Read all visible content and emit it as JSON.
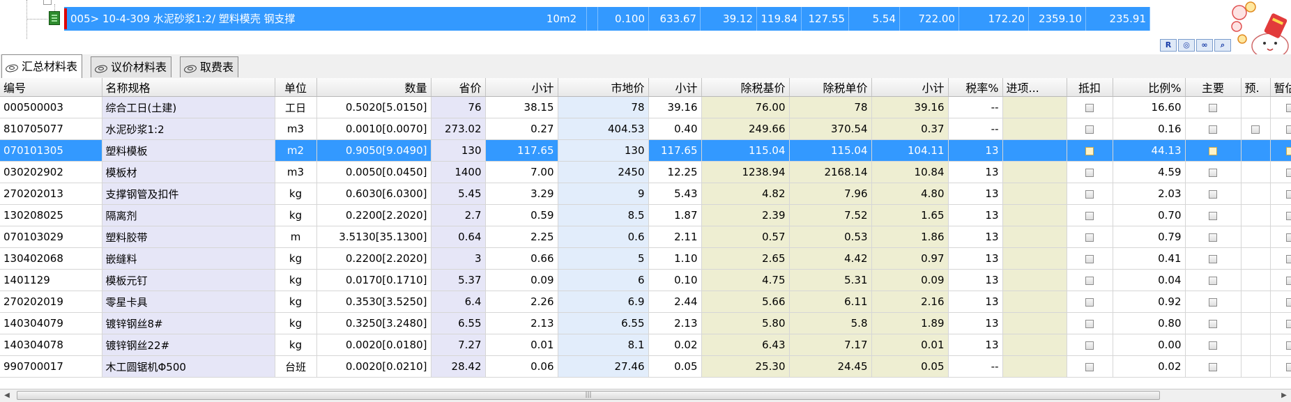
{
  "top_row": {
    "cells": [
      "005> 10-4-309 水泥砂浆1:2/ 塑料模壳 钢支撑",
      "10m2",
      "0.100",
      "633.67",
      "39.12",
      "119.84",
      "127.55",
      "5.54",
      "722.00",
      "172.20",
      "2359.10",
      "235.91"
    ]
  },
  "tabs": [
    {
      "label": "汇总材料表"
    },
    {
      "label": "议价材料表"
    },
    {
      "label": "取费表"
    }
  ],
  "table": {
    "headers": [
      "编号",
      "名称规格",
      "单位",
      "数量",
      "省价",
      "小计",
      "市地价",
      "小计",
      "除税基价",
      "除税单价",
      "小计",
      "税率%",
      "进项...",
      "抵扣",
      "比例%",
      "主要",
      "预.",
      "暂估"
    ],
    "rows": [
      [
        "000500003",
        "综合工日(土建)",
        "工日",
        "0.5020[5.0150]",
        "76",
        "38.15",
        "78",
        "39.16",
        "76.00",
        "78",
        "39.16",
        "--",
        "",
        "",
        "16.60",
        "",
        "",
        ""
      ],
      [
        "810705077",
        "水泥砂浆1:2",
        "m3",
        "0.0010[0.0070]",
        "273.02",
        "0.27",
        "404.53",
        "0.40",
        "249.66",
        "370.54",
        "0.37",
        "--",
        "",
        "",
        "0.16",
        "",
        "",
        ""
      ],
      [
        "070101305",
        "塑料模板",
        "m2",
        "0.9050[9.0490]",
        "130",
        "117.65",
        "130",
        "117.65",
        "115.04",
        "115.04",
        "104.11",
        "13",
        "",
        "",
        "44.13",
        "",
        "",
        ""
      ],
      [
        "030202902",
        "模板材",
        "m3",
        "0.0050[0.0450]",
        "1400",
        "7.00",
        "2450",
        "12.25",
        "1238.94",
        "2168.14",
        "10.84",
        "13",
        "",
        "",
        "4.59",
        "",
        "",
        ""
      ],
      [
        "270202013",
        "支撑钢管及扣件",
        "kg",
        "0.6030[6.0300]",
        "5.45",
        "3.29",
        "9",
        "5.43",
        "4.82",
        "7.96",
        "4.80",
        "13",
        "",
        "",
        "2.03",
        "",
        "",
        ""
      ],
      [
        "130208025",
        "隔离剂",
        "kg",
        "0.2200[2.2020]",
        "2.7",
        "0.59",
        "8.5",
        "1.87",
        "2.39",
        "7.52",
        "1.65",
        "13",
        "",
        "",
        "0.70",
        "",
        "",
        ""
      ],
      [
        "070103029",
        "塑料胶带",
        "m",
        "3.5130[35.1300]",
        "0.64",
        "2.25",
        "0.6",
        "2.11",
        "0.57",
        "0.53",
        "1.86",
        "13",
        "",
        "",
        "0.79",
        "",
        "",
        ""
      ],
      [
        "130402068",
        "嵌缝料",
        "kg",
        "0.2200[2.2020]",
        "3",
        "0.66",
        "5",
        "1.10",
        "2.65",
        "4.42",
        "0.97",
        "13",
        "",
        "",
        "0.41",
        "",
        "",
        ""
      ],
      [
        "1401129",
        "模板元钉",
        "kg",
        "0.0170[0.1710]",
        "5.37",
        "0.09",
        "6",
        "0.10",
        "4.75",
        "5.31",
        "0.09",
        "13",
        "",
        "",
        "0.04",
        "",
        "",
        ""
      ],
      [
        "270202019",
        "零星卡具",
        "kg",
        "0.3530[3.5250]",
        "6.4",
        "2.26",
        "6.9",
        "2.44",
        "5.66",
        "6.11",
        "2.16",
        "13",
        "",
        "",
        "0.92",
        "",
        "",
        ""
      ],
      [
        "140304079",
        "镀锌钢丝8#",
        "kg",
        "0.3250[3.2480]",
        "6.55",
        "2.13",
        "6.55",
        "2.13",
        "5.80",
        "5.8",
        "1.89",
        "13",
        "",
        "",
        "0.80",
        "",
        "",
        ""
      ],
      [
        "140304078",
        "镀锌钢丝22#",
        "kg",
        "0.0020[0.0180]",
        "7.27",
        "0.01",
        "8.1",
        "0.02",
        "6.43",
        "7.17",
        "0.01",
        "13",
        "",
        "",
        "0.00",
        "",
        "",
        ""
      ],
      [
        "990700017",
        "木工圆锯机Φ500",
        "台班",
        "0.0020[0.0210]",
        "28.42",
        "0.06",
        "27.46",
        "0.05",
        "25.30",
        "24.45",
        "0.05",
        "--",
        "",
        "",
        "0.02",
        "",
        "",
        ""
      ]
    ],
    "selected_row": 2
  },
  "mini_tools": [
    "R",
    "◎",
    "∞",
    "⌕"
  ],
  "colors": {
    "selection": "#3399ff",
    "highlight_red": "#e00000",
    "tax_bg": "#eeeed2",
    "lav_bg": "#e6e6f7",
    "blue_bg": "#e2edfb"
  }
}
